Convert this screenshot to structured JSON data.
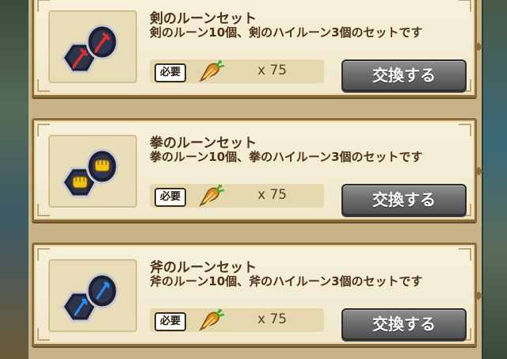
{
  "requirement_label": "必要",
  "exchange_button_label": "交換する",
  "items": [
    {
      "title": "剣のルーンセット",
      "description": "剣のルーン10個、剣のハイルーン3個のセットです",
      "quantity": "x 75",
      "rune_icon": "sword-rune-icon",
      "rune_color": "#e0302a"
    },
    {
      "title": "拳のルーンセット",
      "description": "拳のルーン10個、拳のハイルーン3個のセットです",
      "quantity": "x 75",
      "rune_icon": "fist-rune-icon",
      "rune_color": "#f2c21a"
    },
    {
      "title": "斧のルーンセット",
      "description": "斧のルーン10個、斧のハイルーン3個のセットです",
      "quantity": "x 75",
      "rune_icon": "axe-rune-icon",
      "rune_color": "#2a8cf0"
    }
  ]
}
